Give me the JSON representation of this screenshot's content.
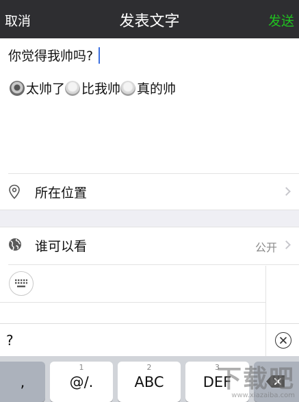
{
  "navbar": {
    "cancel_label": "取消",
    "title": "发表文字",
    "send_label": "发送",
    "send_color": "#20c020"
  },
  "composer": {
    "text": "你觉得我帅吗?"
  },
  "poll": {
    "options": [
      {
        "label": "太帅了",
        "selected": true
      },
      {
        "label": "比我帅",
        "selected": false
      },
      {
        "label": "真的帅",
        "selected": false
      }
    ]
  },
  "location_row": {
    "label": "所在位置",
    "icon": "location-pin-icon"
  },
  "visibility_row": {
    "label": "谁可以看",
    "value": "公开",
    "icon": "globe-icon"
  },
  "input_bar": {
    "text": "?"
  },
  "keyboard": {
    "keys": [
      {
        "num": "",
        "main": ","
      },
      {
        "num": "1",
        "main": "@/."
      },
      {
        "num": "2",
        "main": "ABC"
      },
      {
        "num": "3",
        "main": "DEF"
      },
      {
        "num": "",
        "main": ""
      }
    ]
  },
  "watermark": {
    "text": "下载吧",
    "url": "www.xiazaiba.com"
  }
}
